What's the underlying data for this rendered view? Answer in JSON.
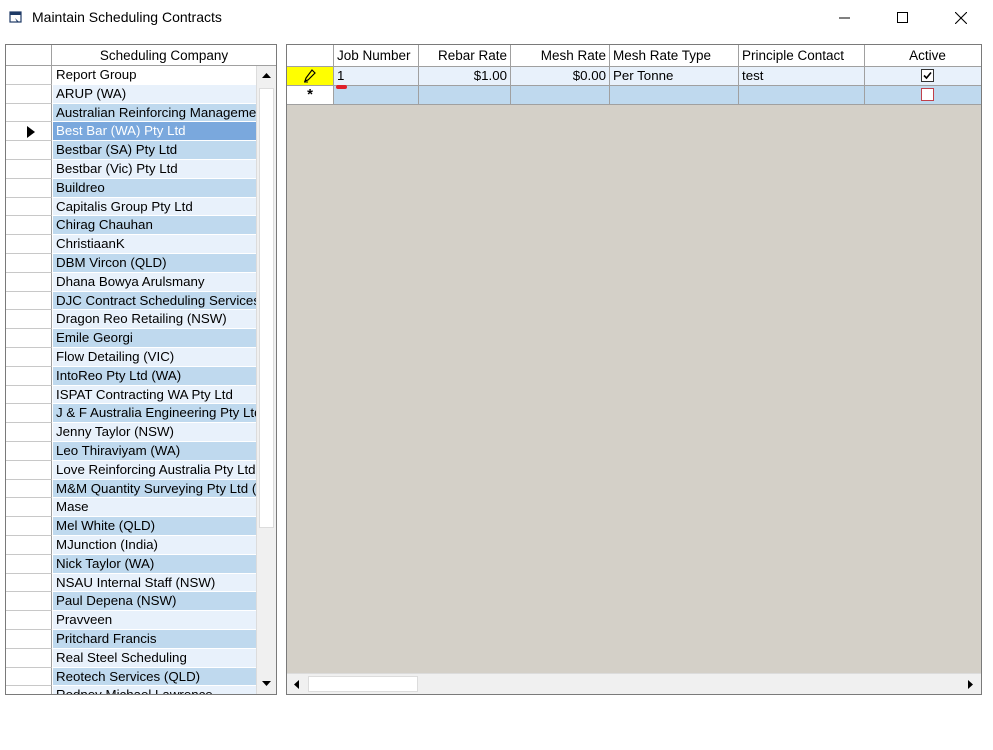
{
  "window": {
    "title": "Maintain Scheduling Contracts",
    "minimize_icon": "minimize-icon",
    "maximize_icon": "maximize-icon",
    "close_icon": "close-icon"
  },
  "left_grid": {
    "header": "Scheduling Company",
    "selected_index": 3,
    "rows": [
      "Report Group",
      "ARUP (WA)",
      "Australian Reinforcing Manageme",
      "Best Bar (WA) Pty Ltd",
      "Bestbar (SA) Pty Ltd",
      "Bestbar (Vic) Pty Ltd",
      "Buildreo",
      "Capitalis Group Pty Ltd",
      "Chirag Chauhan",
      "ChristiaanK",
      "DBM Vircon (QLD)",
      "Dhana Bowya Arulsmany",
      "DJC Contract Scheduling Services",
      "Dragon Reo Retailing (NSW)",
      "Emile Georgi",
      "Flow Detailing (VIC)",
      "IntoReo Pty Ltd (WA)",
      "ISPAT Contracting WA Pty Ltd",
      "J & F Australia Engineering Pty Ltd",
      "Jenny Taylor (NSW)",
      "Leo Thiraviyam (WA)",
      "Love Reinforcing Australia Pty Ltd",
      "M&M Quantity Surveying Pty Ltd (",
      "Mase",
      "Mel White (QLD)",
      "MJunction (India)",
      "Nick Taylor (WA)",
      "NSAU Internal Staff (NSW)",
      "Paul Depena (NSW)",
      "Pravveen",
      "Pritchard Francis",
      "Real Steel Scheduling",
      "Reotech Services (QLD)",
      "Rodney Michael Lawrence"
    ]
  },
  "right_grid": {
    "columns": [
      "Job Number",
      "Rebar Rate",
      "Mesh Rate",
      "Mesh Rate Type",
      "Principle Contact",
      "Active"
    ],
    "rows": [
      {
        "job_number": "1",
        "rebar_rate": "$1.00",
        "mesh_rate": "$0.00",
        "mesh_rate_type": "Per Tonne",
        "principle_contact": "test",
        "active": true
      }
    ],
    "new_row_marker": "*"
  },
  "colors": {
    "row_light": "#e8f1fb",
    "row_dark": "#bfd9ee",
    "row_selected": "#7aa8dd",
    "edit_indicator": "#ffff00",
    "grid_background": "#d4d0c8"
  }
}
